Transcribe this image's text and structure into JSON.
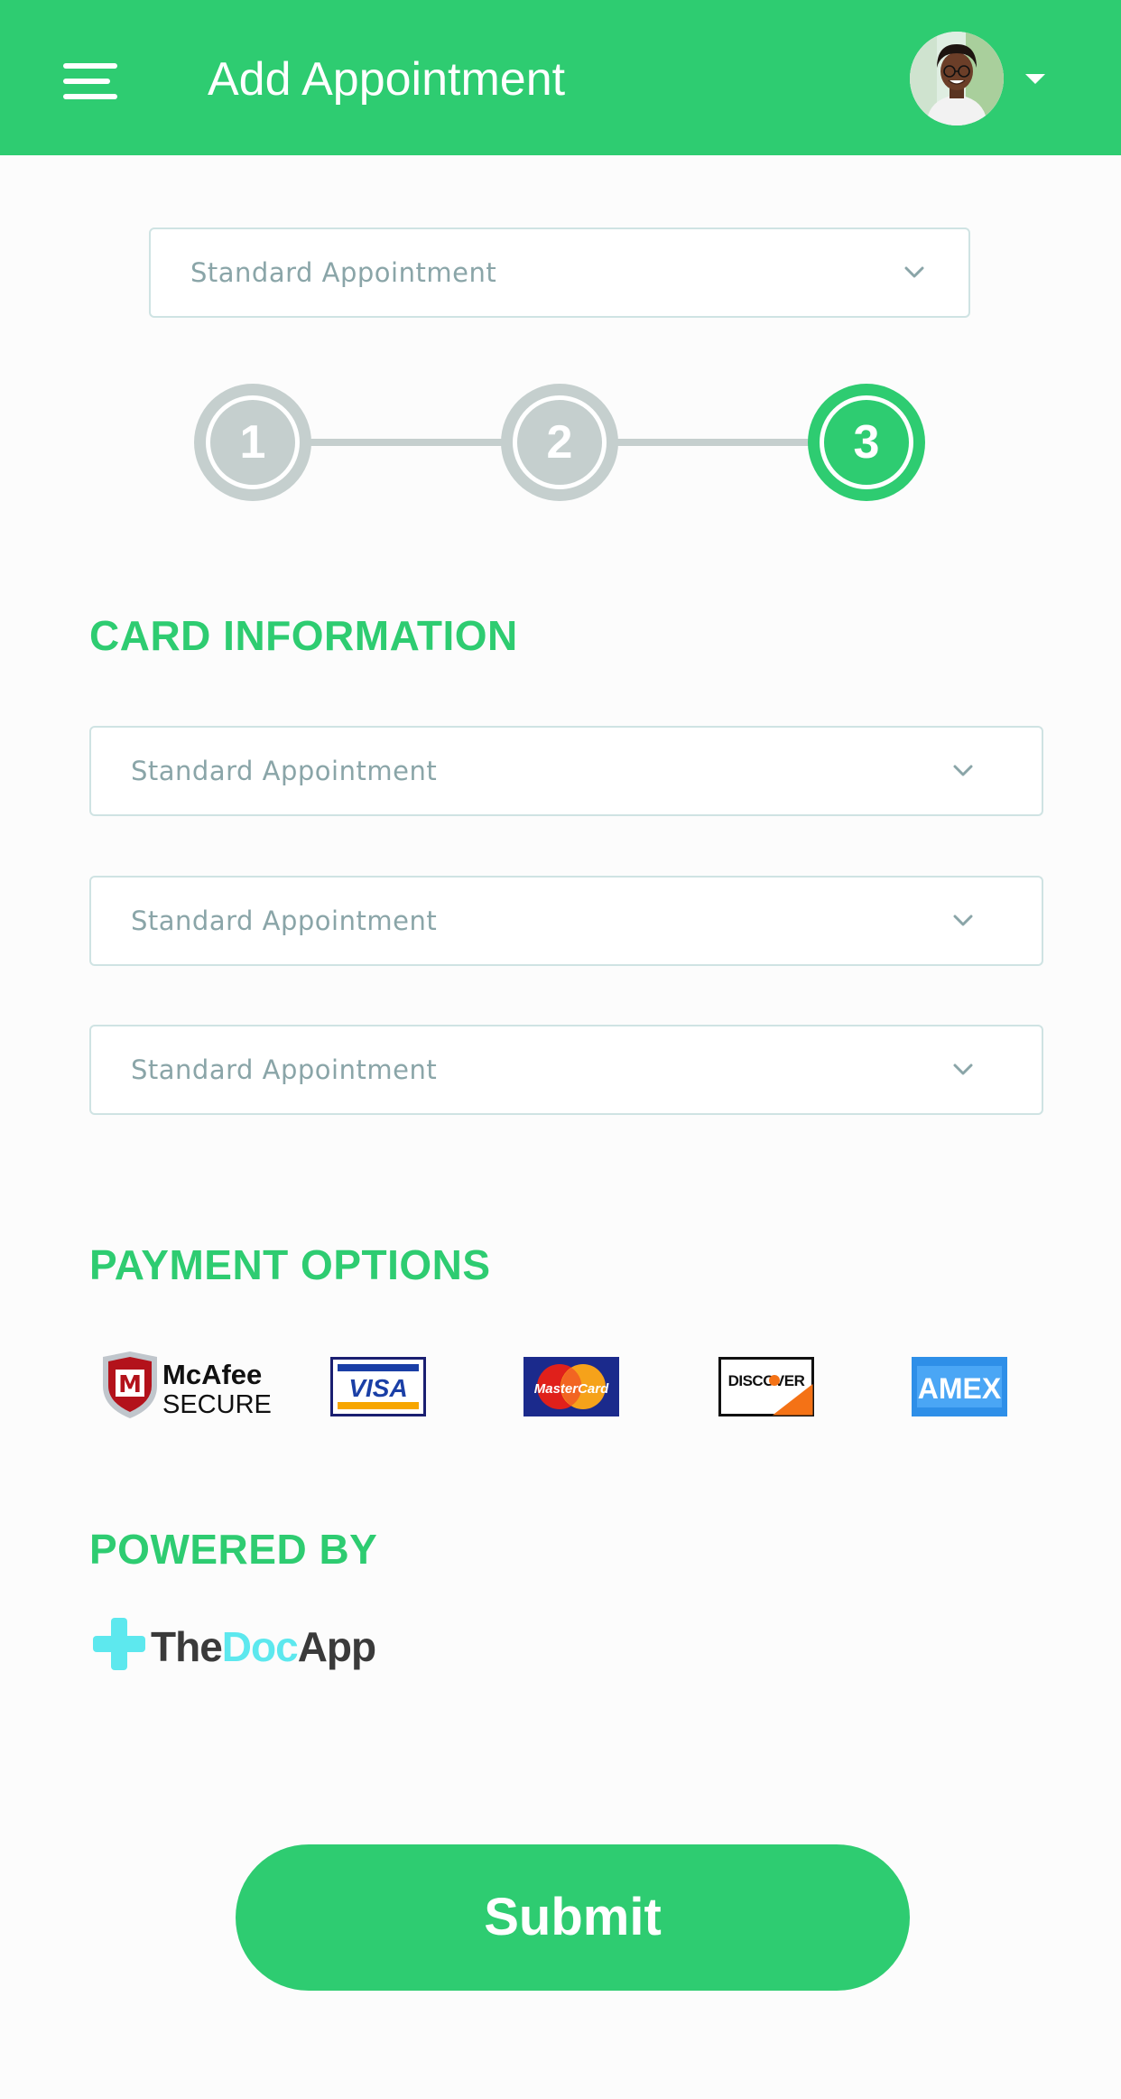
{
  "header": {
    "title": "Add Appointment",
    "menu_icon": "hamburger-menu-icon",
    "avatar_icon": "user-avatar",
    "caret_icon": "caret-down-icon"
  },
  "appointment_type": {
    "value": "Standard Appointment"
  },
  "stepper": {
    "steps": [
      "1",
      "2",
      "3"
    ],
    "current_step": 3
  },
  "card_information": {
    "title": "CARD INFORMATION",
    "fields": [
      {
        "value": "Standard Appointment"
      },
      {
        "value": "Standard Appointment"
      },
      {
        "value": "Standard Appointment"
      }
    ]
  },
  "payment_options": {
    "title": "PAYMENT OPTIONS",
    "logos": [
      {
        "name": "mcafee-secure",
        "line1": "McAfee",
        "line2": "SECURE"
      },
      {
        "name": "visa",
        "text": "VISA"
      },
      {
        "name": "mastercard",
        "text": "MasterCard"
      },
      {
        "name": "discover",
        "text": "DISCOVER"
      },
      {
        "name": "amex",
        "text": "AMEX"
      }
    ]
  },
  "powered_by": {
    "title": "POWERED BY",
    "brand_parts": [
      "The",
      "Doc",
      "App"
    ]
  },
  "submit": {
    "label": "Submit"
  },
  "colors": {
    "primary": "#2ecc71",
    "step_inactive": "#c5cfce",
    "field_border": "#cfe3e3",
    "field_text": "#8aa5a8",
    "brand_cyan": "#5de8ee"
  }
}
